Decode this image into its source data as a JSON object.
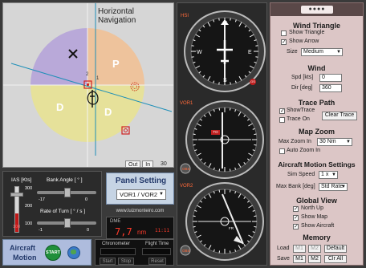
{
  "map": {
    "title": "Horizontal Navigation",
    "sector_p": "P",
    "sector_d_left": "D",
    "sector_d_right": "D",
    "btn_out": "Out",
    "btn_in": "In",
    "range": "30 Nm"
  },
  "ias": {
    "label": "IAS [Kts]",
    "ticks": [
      "300",
      "200",
      "100"
    ],
    "value_label": "100"
  },
  "bank": {
    "label": "Bank Angle [ ° ]",
    "left": "-17",
    "right": "0"
  },
  "turn": {
    "label": "Rate of Turn [ ° / s ]",
    "left": "-1",
    "right": "0"
  },
  "panel_setting": {
    "title": "Panel Setting",
    "selected": "VOR1 / VOR2"
  },
  "url": "www.luizmonteiro.com",
  "dme": {
    "label": "DME",
    "value": "7,7",
    "unit": "nm",
    "extra": "11:11"
  },
  "aircraft_motion": {
    "label_line1": "Aircraft",
    "label_line2": "Motion",
    "start": "START"
  },
  "chronometer": {
    "label": "Chronometer",
    "btn_start": "Start",
    "btn_stop": "Stop"
  },
  "flight_time": {
    "label": "Flight Time",
    "btn_reset": "Reset"
  },
  "instruments": {
    "hsi_label": "HSI",
    "vor1_label": "VOR1",
    "vor2_label": "VOR2",
    "obs1": "OBS",
    "obs2": "OBS",
    "to_flag": "TO",
    "fr_flag": "FR",
    "alert_flag": "GS"
  },
  "settings": {
    "wind_triangle": {
      "title": "Wind Triangle",
      "show_triangle": "Show Triangle",
      "show_triangle_checked": false,
      "show_arrow": "Show Arrow",
      "show_arrow_checked": true,
      "size_label": "Size",
      "size_value": "Medium"
    },
    "wind": {
      "title": "Wind",
      "spd_label": "Spd [kts]",
      "spd_value": "0",
      "dir_label": "Dir [deg]",
      "dir_value": "360"
    },
    "trace": {
      "title": "Trace Path",
      "show_trace": "ShowTrace",
      "show_trace_checked": true,
      "trace_on": "Trace On",
      "trace_on_checked": false,
      "clear": "Clear Trace"
    },
    "zoom": {
      "title": "Map Zoom",
      "max_zoom_label": "Max Zoom In",
      "max_zoom_value": "30 Nm",
      "auto_zoom": "Auto Zoom In",
      "auto_zoom_checked": false
    },
    "motion": {
      "title": "Aircraft Motion Settings",
      "sim_speed_label": "Sim Speed",
      "sim_speed_value": "1 x",
      "max_bank_label": "Max Bank [deg]",
      "max_bank_value": "Std Rate"
    },
    "global_view": {
      "title": "Global View",
      "north_up": "North Up",
      "north_up_checked": true,
      "show_map": "Show Map",
      "show_map_checked": true,
      "show_aircraft": "Show Aircraft",
      "show_aircraft_checked": true
    },
    "memory": {
      "title": "Memory",
      "load_label": "Load",
      "save_label": "Save",
      "m1": "M1",
      "m2": "M2",
      "default": "Default",
      "clr_all": "Clr All"
    }
  },
  "colors": {
    "sector_p": "#b9a9d9",
    "sector_d": "#e6e19a",
    "sector_orange": "#eec39c",
    "course_line": "#1e8fb8",
    "right_bg": "#dcc6c6",
    "instrument_bg": "#2a2a2a"
  }
}
